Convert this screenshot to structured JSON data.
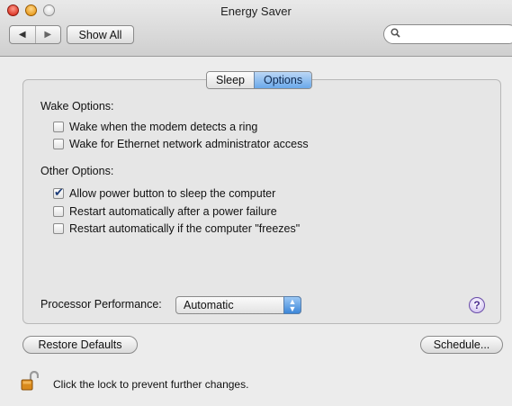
{
  "window": {
    "title": "Energy Saver"
  },
  "toolbar": {
    "back_glyph": "◀",
    "forward_glyph": "▶",
    "show_all_label": "Show All",
    "search_placeholder": "",
    "search_icon": "magnifier-icon"
  },
  "tabs": [
    {
      "label": "Sleep",
      "selected": false
    },
    {
      "label": "Options",
      "selected": true
    }
  ],
  "wake": {
    "heading": "Wake Options:",
    "items": [
      {
        "label": "Wake when the modem detects a ring",
        "checked": false
      },
      {
        "label": "Wake for Ethernet network administrator access",
        "checked": false
      }
    ]
  },
  "other": {
    "heading": "Other Options:",
    "items": [
      {
        "label": "Allow power button to sleep the computer",
        "checked": true
      },
      {
        "label": "Restart automatically after a power failure",
        "checked": false
      },
      {
        "label": "Restart automatically if the computer \"freezes\"",
        "checked": false
      }
    ]
  },
  "processor": {
    "label": "Processor Performance:",
    "selected": "Automatic"
  },
  "help_glyph": "?",
  "buttons": {
    "restore_defaults": "Restore Defaults",
    "schedule": "Schedule..."
  },
  "lock": {
    "text": "Click the lock to prevent further changes.",
    "icon": "unlocked-padlock-icon"
  },
  "colors": {
    "accent": "#6aa8ea",
    "checkmark": "#1c3c7a"
  }
}
